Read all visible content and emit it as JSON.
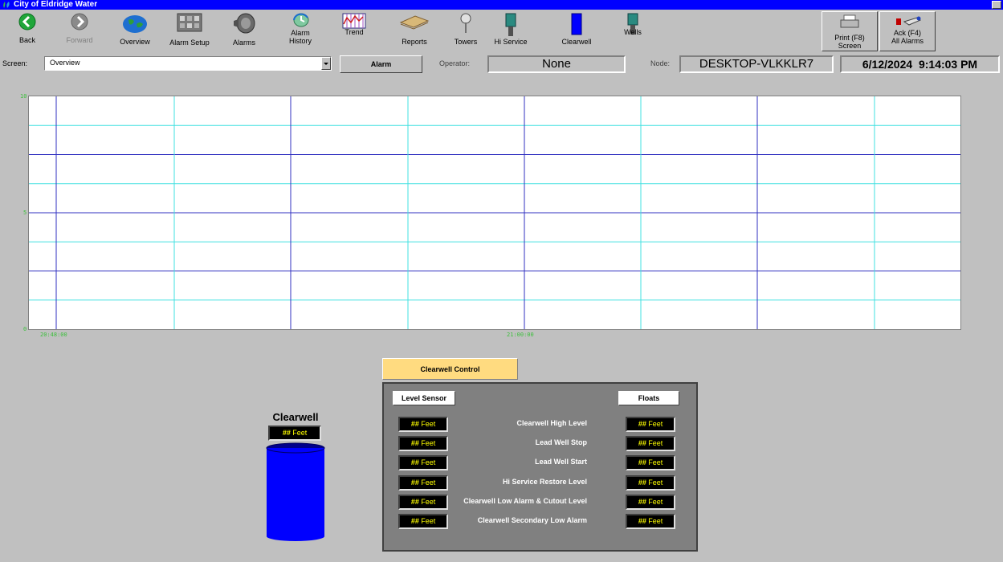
{
  "window": {
    "title": "City of Eldridge Water"
  },
  "toolbar": {
    "buttons": [
      {
        "label": "Back",
        "icon": "back-arrow-icon"
      },
      {
        "label": "Forward",
        "icon": "forward-arrow-icon"
      },
      {
        "label": "Overview",
        "icon": "globe-icon"
      },
      {
        "label": "Alarm Setup",
        "icon": "alarm-setup-icon"
      },
      {
        "label": "Alarms",
        "icon": "speaker-icon"
      },
      {
        "label": "Alarm\nHistory",
        "icon": "history-icon"
      },
      {
        "label": "Trend",
        "icon": "trend-chart-icon"
      },
      {
        "label": "Reports",
        "icon": "reports-icon"
      },
      {
        "label": "Towers",
        "icon": "water-tower-icon"
      },
      {
        "label": "Hi Service",
        "icon": "pump-icon"
      },
      {
        "label": "Clearwell",
        "icon": "clearwell-tank-icon"
      },
      {
        "label": "Wells",
        "icon": "well-pump-icon"
      }
    ],
    "print_label": "Print (F8)\nScreen",
    "ack_label": "Ack (F4)\nAll Alarms"
  },
  "infobar": {
    "screen_label": "Screen:",
    "screen_value": "Overview",
    "alarm_label": "Alarm",
    "operator_label": "Operator:",
    "operator_value": "None",
    "node_label": "Node:",
    "node_value": "DESKTOP-VLKKLR7",
    "date": "6/12/2024",
    "time": "9:14:03 PM"
  },
  "chart_data": {
    "type": "line",
    "y_ticks": [
      "10",
      "5",
      "0"
    ],
    "x_ticks": [
      "20:48:00",
      "21:00:00"
    ],
    "series": []
  },
  "clearwell": {
    "tank_title": "Clearwell",
    "tank_value": "##",
    "unit": "Feet",
    "tank_color": "#0000ff"
  },
  "control": {
    "title": "Clearwell Control",
    "level_sensor_label": "Level Sensor",
    "floats_label": "Floats",
    "rows": [
      {
        "label": "Clearwell High Level",
        "sensor": "##",
        "float": "##"
      },
      {
        "label": "Lead Well Stop",
        "sensor": "##",
        "float": "##"
      },
      {
        "label": "Lead Well Start",
        "sensor": "##",
        "float": "##"
      },
      {
        "label": "Hi Service Restore Level",
        "sensor": "##",
        "float": "##"
      },
      {
        "label": "Clearwell Low Alarm & Cutout Level",
        "sensor": "##",
        "float": "##"
      },
      {
        "label": "Clearwell Secondary Low Alarm",
        "sensor": "##",
        "float": "##"
      }
    ]
  }
}
